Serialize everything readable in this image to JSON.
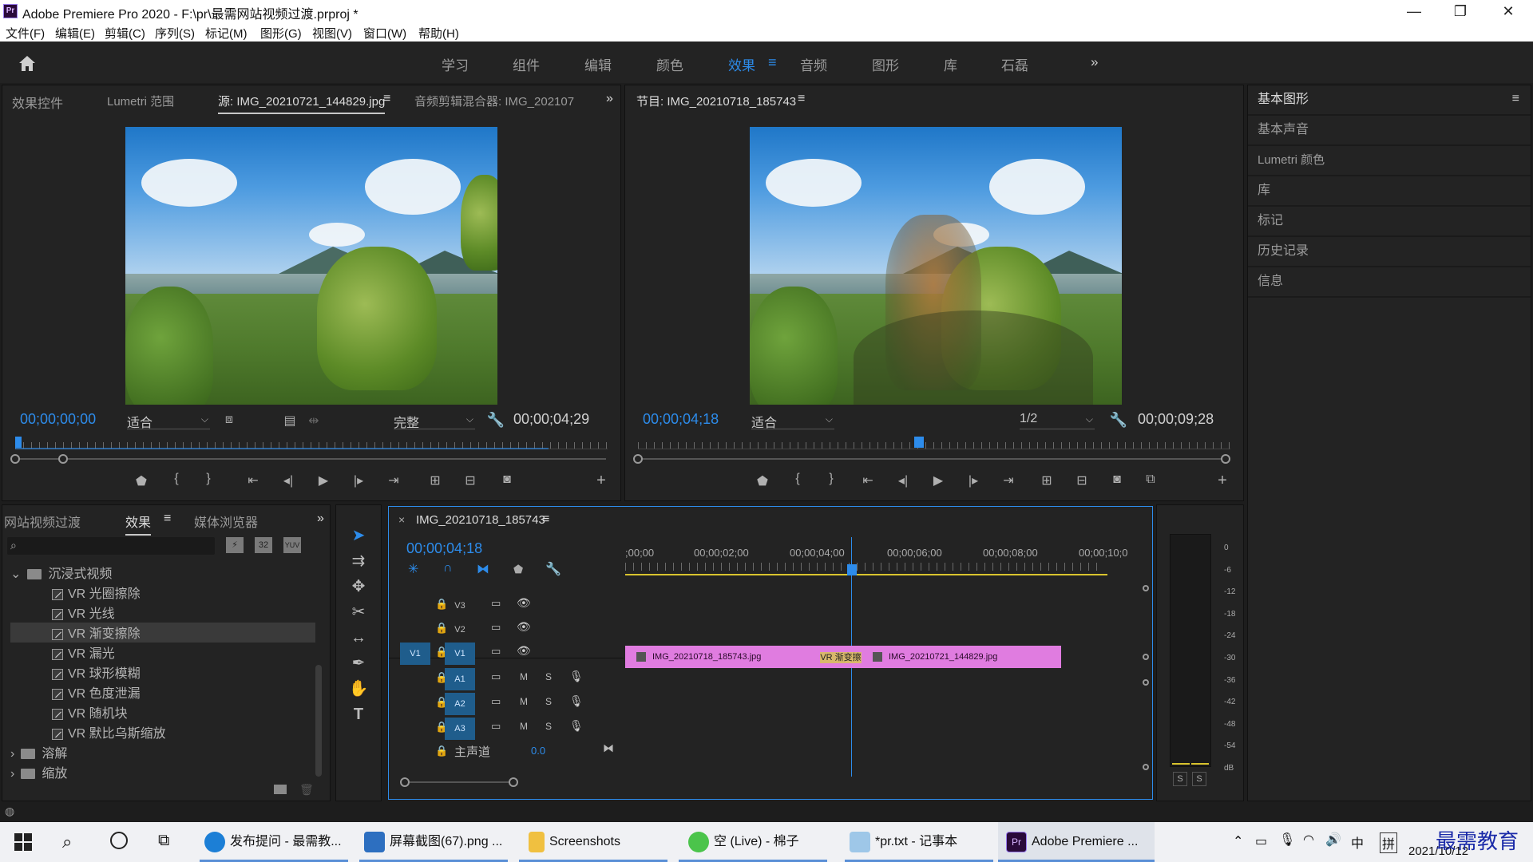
{
  "window": {
    "title": "Adobe Premiere Pro 2020 - F:\\pr\\最需网站视频过渡.prproj *",
    "app_icon": "Pr",
    "buttons": [
      "—",
      "❐",
      "✕"
    ]
  },
  "menu": [
    "文件(F)",
    "编辑(E)",
    "剪辑(C)",
    "序列(S)",
    "标记(M)",
    "图形(G)",
    "视图(V)",
    "窗口(W)",
    "帮助(H)"
  ],
  "workspaces": {
    "items": [
      "学习",
      "组件",
      "编辑",
      "颜色",
      "效果",
      "音频",
      "图形",
      "库",
      "石磊"
    ],
    "active": "效果",
    "menu_glyph": "≡",
    "overflow": "»"
  },
  "source_panel": {
    "tabs": [
      "效果控件",
      "Lumetri 范围",
      "源: IMG_20210721_144829.jpg",
      "音频剪辑混合器: IMG_202107"
    ],
    "active_tab": "源: IMG_20210721_144829.jpg",
    "tab_menu": "≡",
    "overflow": "»",
    "timecode_in": "00;00;00;00",
    "zoom": "适合",
    "quality": "完整",
    "duration": "00;00;04;29"
  },
  "program_panel": {
    "title": "节目: IMG_20210718_185743",
    "menu": "≡",
    "timecode": "00;00;04;18",
    "zoom": "适合",
    "quality": "1/2",
    "duration": "00;00;09;28"
  },
  "right_panel": {
    "items": [
      "基本图形",
      "基本声音",
      "Lumetri 颜色",
      "库",
      "标记",
      "历史记录",
      "信息"
    ],
    "menu": "≡"
  },
  "effects_panel": {
    "tabs": [
      "网站视频过渡",
      "效果",
      "媒体浏览器"
    ],
    "active_tab": "效果",
    "tab_menu": "≡",
    "overflow": "»",
    "search_placeholder": "",
    "preset_badges": [
      "32",
      "YUV"
    ],
    "tree": [
      {
        "type": "folder",
        "label": "沉浸式视频",
        "expanded": true
      },
      {
        "type": "effect",
        "label": "VR 光圈擦除"
      },
      {
        "type": "effect",
        "label": "VR 光线"
      },
      {
        "type": "effect",
        "label": "VR 渐变擦除",
        "selected": true
      },
      {
        "type": "effect",
        "label": "VR 漏光"
      },
      {
        "type": "effect",
        "label": "VR 球形模糊"
      },
      {
        "type": "effect",
        "label": "VR 色度泄漏"
      },
      {
        "type": "effect",
        "label": "VR 随机块"
      },
      {
        "type": "effect",
        "label": "VR 默比乌斯缩放"
      },
      {
        "type": "folder",
        "label": "溶解",
        "expanded": false
      },
      {
        "type": "folder",
        "label": "缩放",
        "expanded": false
      }
    ]
  },
  "timeline": {
    "close": "×",
    "sequence": "IMG_20210718_185743",
    "menu": "≡",
    "timecode": "00;00;04;18",
    "ruler": [
      ";00;00",
      "00;00;02;00",
      "00;00;04;00",
      "00;00;06;00",
      "00;00;08;00",
      "00;00;10;0"
    ],
    "video_tracks": [
      "V3",
      "V2",
      "V1"
    ],
    "audio_tracks": [
      "A1",
      "A2",
      "A3"
    ],
    "source_patch": "V1",
    "track_toggles": {
      "mute": "M",
      "solo": "S"
    },
    "master_label": "主声道",
    "master_value": "0.0",
    "clip1": "IMG_20210718_185743.jpg",
    "clip2": "IMG_20210721_144829.jpg",
    "transition": "VR 渐变擦",
    "clip_color": "#e07ce0"
  },
  "audio_meter": {
    "scale": [
      "0",
      "-6",
      "-12",
      "-18",
      "-24",
      "-30",
      "-36",
      "-42",
      "-48",
      "-54",
      "dB"
    ],
    "solo": [
      "S",
      "S"
    ]
  },
  "taskbar": {
    "tasks": [
      "发布提问 - 最需教...",
      "屏幕截图(67).png ...",
      "Screenshots",
      "空 (Live) - 棉子",
      "*pr.txt - 记事本",
      "Adobe Premiere ..."
    ],
    "ime": "中",
    "ime2": "拼",
    "date": "2021/10/12",
    "watermark": "最需教育"
  },
  "colors": {
    "accent": "#2d8ceb",
    "panel_bg": "#232323",
    "clip_pink": "#e07ce0",
    "active_track": "#1f5d8c"
  }
}
